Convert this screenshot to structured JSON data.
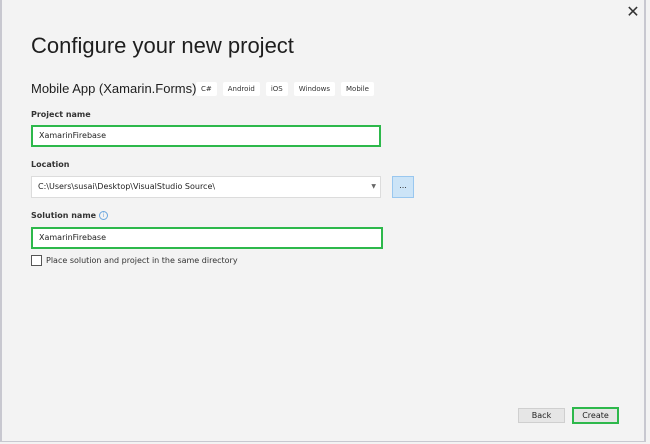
{
  "dialog": {
    "title": "Configure your new project",
    "close_icon": "close-icon"
  },
  "template": {
    "name": "Mobile App (Xamarin.Forms)",
    "tags": [
      "C#",
      "Android",
      "iOS",
      "Windows",
      "Mobile"
    ]
  },
  "project_name": {
    "label": "Project name",
    "value": "XamarinFirebase"
  },
  "location": {
    "label": "Location",
    "value": "C:\\Users\\susai\\Desktop\\VisualStudio Source\\",
    "browse_label": "..."
  },
  "solution_name": {
    "label": "Solution name",
    "value": "XamarinFirebase",
    "info": "i"
  },
  "same_directory": {
    "label": "Place solution and project in the same directory",
    "checked": false
  },
  "buttons": {
    "back": "Back",
    "create": "Create"
  },
  "colors": {
    "highlight": "#2db84b",
    "background": "#f3f3f3",
    "browse": "#cce4f7"
  }
}
